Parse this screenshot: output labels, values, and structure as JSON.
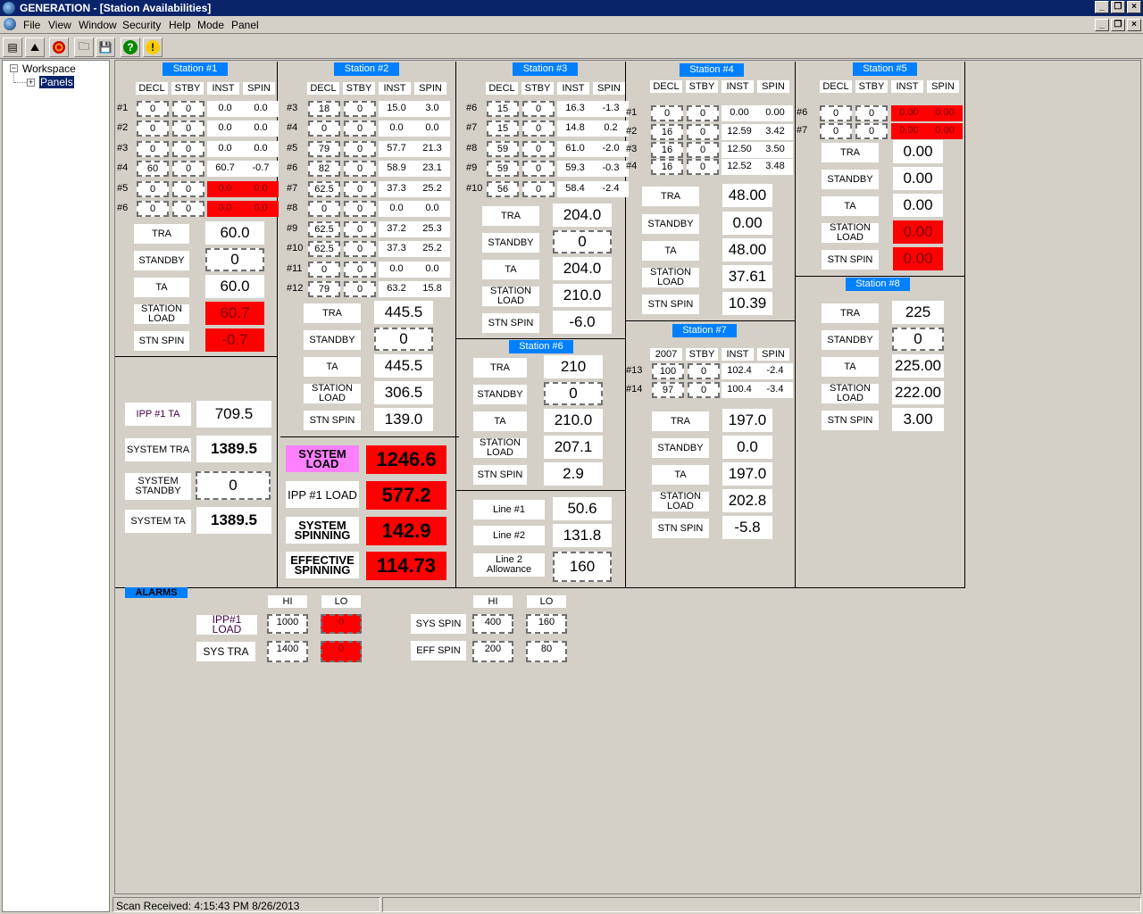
{
  "window": {
    "title": "GENERATION - [Station Availabilities]"
  },
  "menu": [
    "File",
    "View",
    "Window",
    "Security",
    "Help",
    "Mode",
    "Panel"
  ],
  "tree": {
    "root": "Workspace",
    "child": "Panels"
  },
  "status": {
    "scan": "Scan Received: 4:15:43 PM 8/26/2013"
  },
  "headers": [
    "DECL",
    "STBY",
    "INST",
    "SPIN"
  ],
  "labels": {
    "tra": "TRA",
    "standby": "STANDBY",
    "ta": "TA",
    "station_load": "STATION LOAD",
    "stn_spin": "STN SPIN"
  },
  "station1": {
    "name": "Station #1",
    "units": [
      {
        "id": "#1",
        "decl": "0",
        "stby": "0",
        "inst": "0.0",
        "spin": "0.0",
        "alarm": false
      },
      {
        "id": "#2",
        "decl": "0",
        "stby": "0",
        "inst": "0.0",
        "spin": "0.0",
        "alarm": false
      },
      {
        "id": "#3",
        "decl": "0",
        "stby": "0",
        "inst": "0.0",
        "spin": "0.0",
        "alarm": false
      },
      {
        "id": "#4",
        "decl": "60",
        "stby": "0",
        "inst": "60.7",
        "spin": "-0.7",
        "alarm": false
      },
      {
        "id": "#5",
        "decl": "0",
        "stby": "0",
        "inst": "0.0",
        "spin": "0.0",
        "alarm": true
      },
      {
        "id": "#6",
        "decl": "0",
        "stby": "0",
        "inst": "0.0",
        "spin": "0.0",
        "alarm": true
      }
    ],
    "tra": "60.0",
    "standby": "0",
    "ta": "60.0",
    "load": "60.7",
    "spin": "-0.7"
  },
  "station2": {
    "name": "Station #2",
    "units": [
      {
        "id": "#3",
        "decl": "18",
        "stby": "0",
        "inst": "15.0",
        "spin": "3.0"
      },
      {
        "id": "#4",
        "decl": "0",
        "stby": "0",
        "inst": "0.0",
        "spin": "0.0"
      },
      {
        "id": "#5",
        "decl": "79",
        "stby": "0",
        "inst": "57.7",
        "spin": "21.3"
      },
      {
        "id": "#6",
        "decl": "82",
        "stby": "0",
        "inst": "58.9",
        "spin": "23.1"
      },
      {
        "id": "#7",
        "decl": "62.5",
        "stby": "0",
        "inst": "37.3",
        "spin": "25.2"
      },
      {
        "id": "#8",
        "decl": "0",
        "stby": "0",
        "inst": "0.0",
        "spin": "0.0"
      },
      {
        "id": "#9",
        "decl": "62.5",
        "stby": "0",
        "inst": "37.2",
        "spin": "25.3"
      },
      {
        "id": "#10",
        "decl": "62.5",
        "stby": "0",
        "inst": "37.3",
        "spin": "25.2"
      },
      {
        "id": "#11",
        "decl": "0",
        "stby": "0",
        "inst": "0.0",
        "spin": "0.0"
      },
      {
        "id": "#12",
        "decl": "79",
        "stby": "0",
        "inst": "63.2",
        "spin": "15.8"
      }
    ],
    "tra": "445.5",
    "standby": "0",
    "ta": "445.5",
    "load": "306.5",
    "spin": "139.0"
  },
  "station3": {
    "name": "Station #3",
    "units": [
      {
        "id": "#6",
        "decl": "15",
        "stby": "0",
        "inst": "16.3",
        "spin": "-1.3"
      },
      {
        "id": "#7",
        "decl": "15",
        "stby": "0",
        "inst": "14.8",
        "spin": "0.2"
      },
      {
        "id": "#8",
        "decl": "59",
        "stby": "0",
        "inst": "61.0",
        "spin": "-2.0"
      },
      {
        "id": "#9",
        "decl": "59",
        "stby": "0",
        "inst": "59.3",
        "spin": "-0.3"
      },
      {
        "id": "#10",
        "decl": "56",
        "stby": "0",
        "inst": "58.4",
        "spin": "-2.4"
      }
    ],
    "tra": "204.0",
    "standby": "0",
    "ta": "204.0",
    "load": "210.0",
    "spin": "-6.0"
  },
  "station4": {
    "name": "Station #4",
    "units": [
      {
        "id": "#1",
        "decl": "0",
        "stby": "0",
        "inst": "0.00",
        "spin": "0.00"
      },
      {
        "id": "#2",
        "decl": "16",
        "stby": "0",
        "inst": "12.59",
        "spin": "3.42"
      },
      {
        "id": "#3",
        "decl": "16",
        "stby": "0",
        "inst": "12.50",
        "spin": "3.50"
      },
      {
        "id": "#4",
        "decl": "16",
        "stby": "0",
        "inst": "12.52",
        "spin": "3.48"
      }
    ],
    "tra": "48.00",
    "standby": "0.00",
    "ta": "48.00",
    "load": "37.61",
    "spin": "10.39"
  },
  "station5": {
    "name": "Station #5",
    "units": [
      {
        "id": "#6",
        "decl": "0",
        "stby": "0",
        "inst": "0.00",
        "spin": "0.00"
      },
      {
        "id": "#7",
        "decl": "0",
        "stby": "0",
        "inst": "0.00",
        "spin": "0.00"
      }
    ],
    "tra": "0.00",
    "standby": "0.00",
    "ta": "0.00",
    "load": "0.00",
    "spin": "0.00"
  },
  "station6": {
    "name": "Station #6",
    "tra": "210",
    "standby": "0",
    "ta": "210.0",
    "load": "207.1",
    "spin": "2.9"
  },
  "station7": {
    "name": "Station #7",
    "decl_header": "2007",
    "units": [
      {
        "id": "#13",
        "decl": "100",
        "stby": "0",
        "inst": "102.4",
        "spin": "-2.4"
      },
      {
        "id": "#14",
        "decl": "97",
        "stby": "0",
        "inst": "100.4",
        "spin": "-3.4"
      }
    ],
    "tra": "197.0",
    "standby": "0.0",
    "ta": "197.0",
    "load": "202.8",
    "spin": "-5.8"
  },
  "station8": {
    "name": "Station #8",
    "tra": "225",
    "standby": "0",
    "ta": "225.00",
    "load": "222.00",
    "spin": "3.00"
  },
  "lines": {
    "l1_label": "Line #1",
    "l1": "50.6",
    "l2_label": "Line #2",
    "l2": "131.8",
    "allow_label": "Line 2 Allowance",
    "allow": "160"
  },
  "system": {
    "ipp_ta_label": "IPP #1 TA",
    "ipp_ta": "709.5",
    "tra_label": "SYSTEM TRA",
    "tra": "1389.5",
    "standby_label": "SYSTEM STANDBY",
    "standby": "0",
    "ta_label": "SYSTEM TA",
    "ta": "1389.5",
    "load_label": "SYSTEM LOAD",
    "load": "1246.6",
    "ipp_load_label": "IPP #1 LOAD",
    "ipp_load": "577.2",
    "spinning_label": "SYSTEM SPINNING",
    "spinning": "142.9",
    "eff_label": "EFFECTIVE SPINNING",
    "eff": "114.73"
  },
  "alarms": {
    "title": "ALARMS",
    "hi": "HI",
    "lo": "LO",
    "ipp_label": "IPP#1 LOAD",
    "ipp_hi": "1000",
    "ipp_lo": "0",
    "tra_label": "SYS TRA",
    "tra_hi": "1400",
    "tra_lo": "0",
    "spin_label": "SYS SPIN",
    "spin_hi": "400",
    "spin_lo": "160",
    "eff_label": "EFF SPIN",
    "eff_hi": "200",
    "eff_lo": "80"
  },
  "colors": {
    "header_blue": "#0080ff",
    "alarm_red": "#ff0000",
    "title_blue": "#0a246a",
    "pink": "#ff80ff"
  }
}
